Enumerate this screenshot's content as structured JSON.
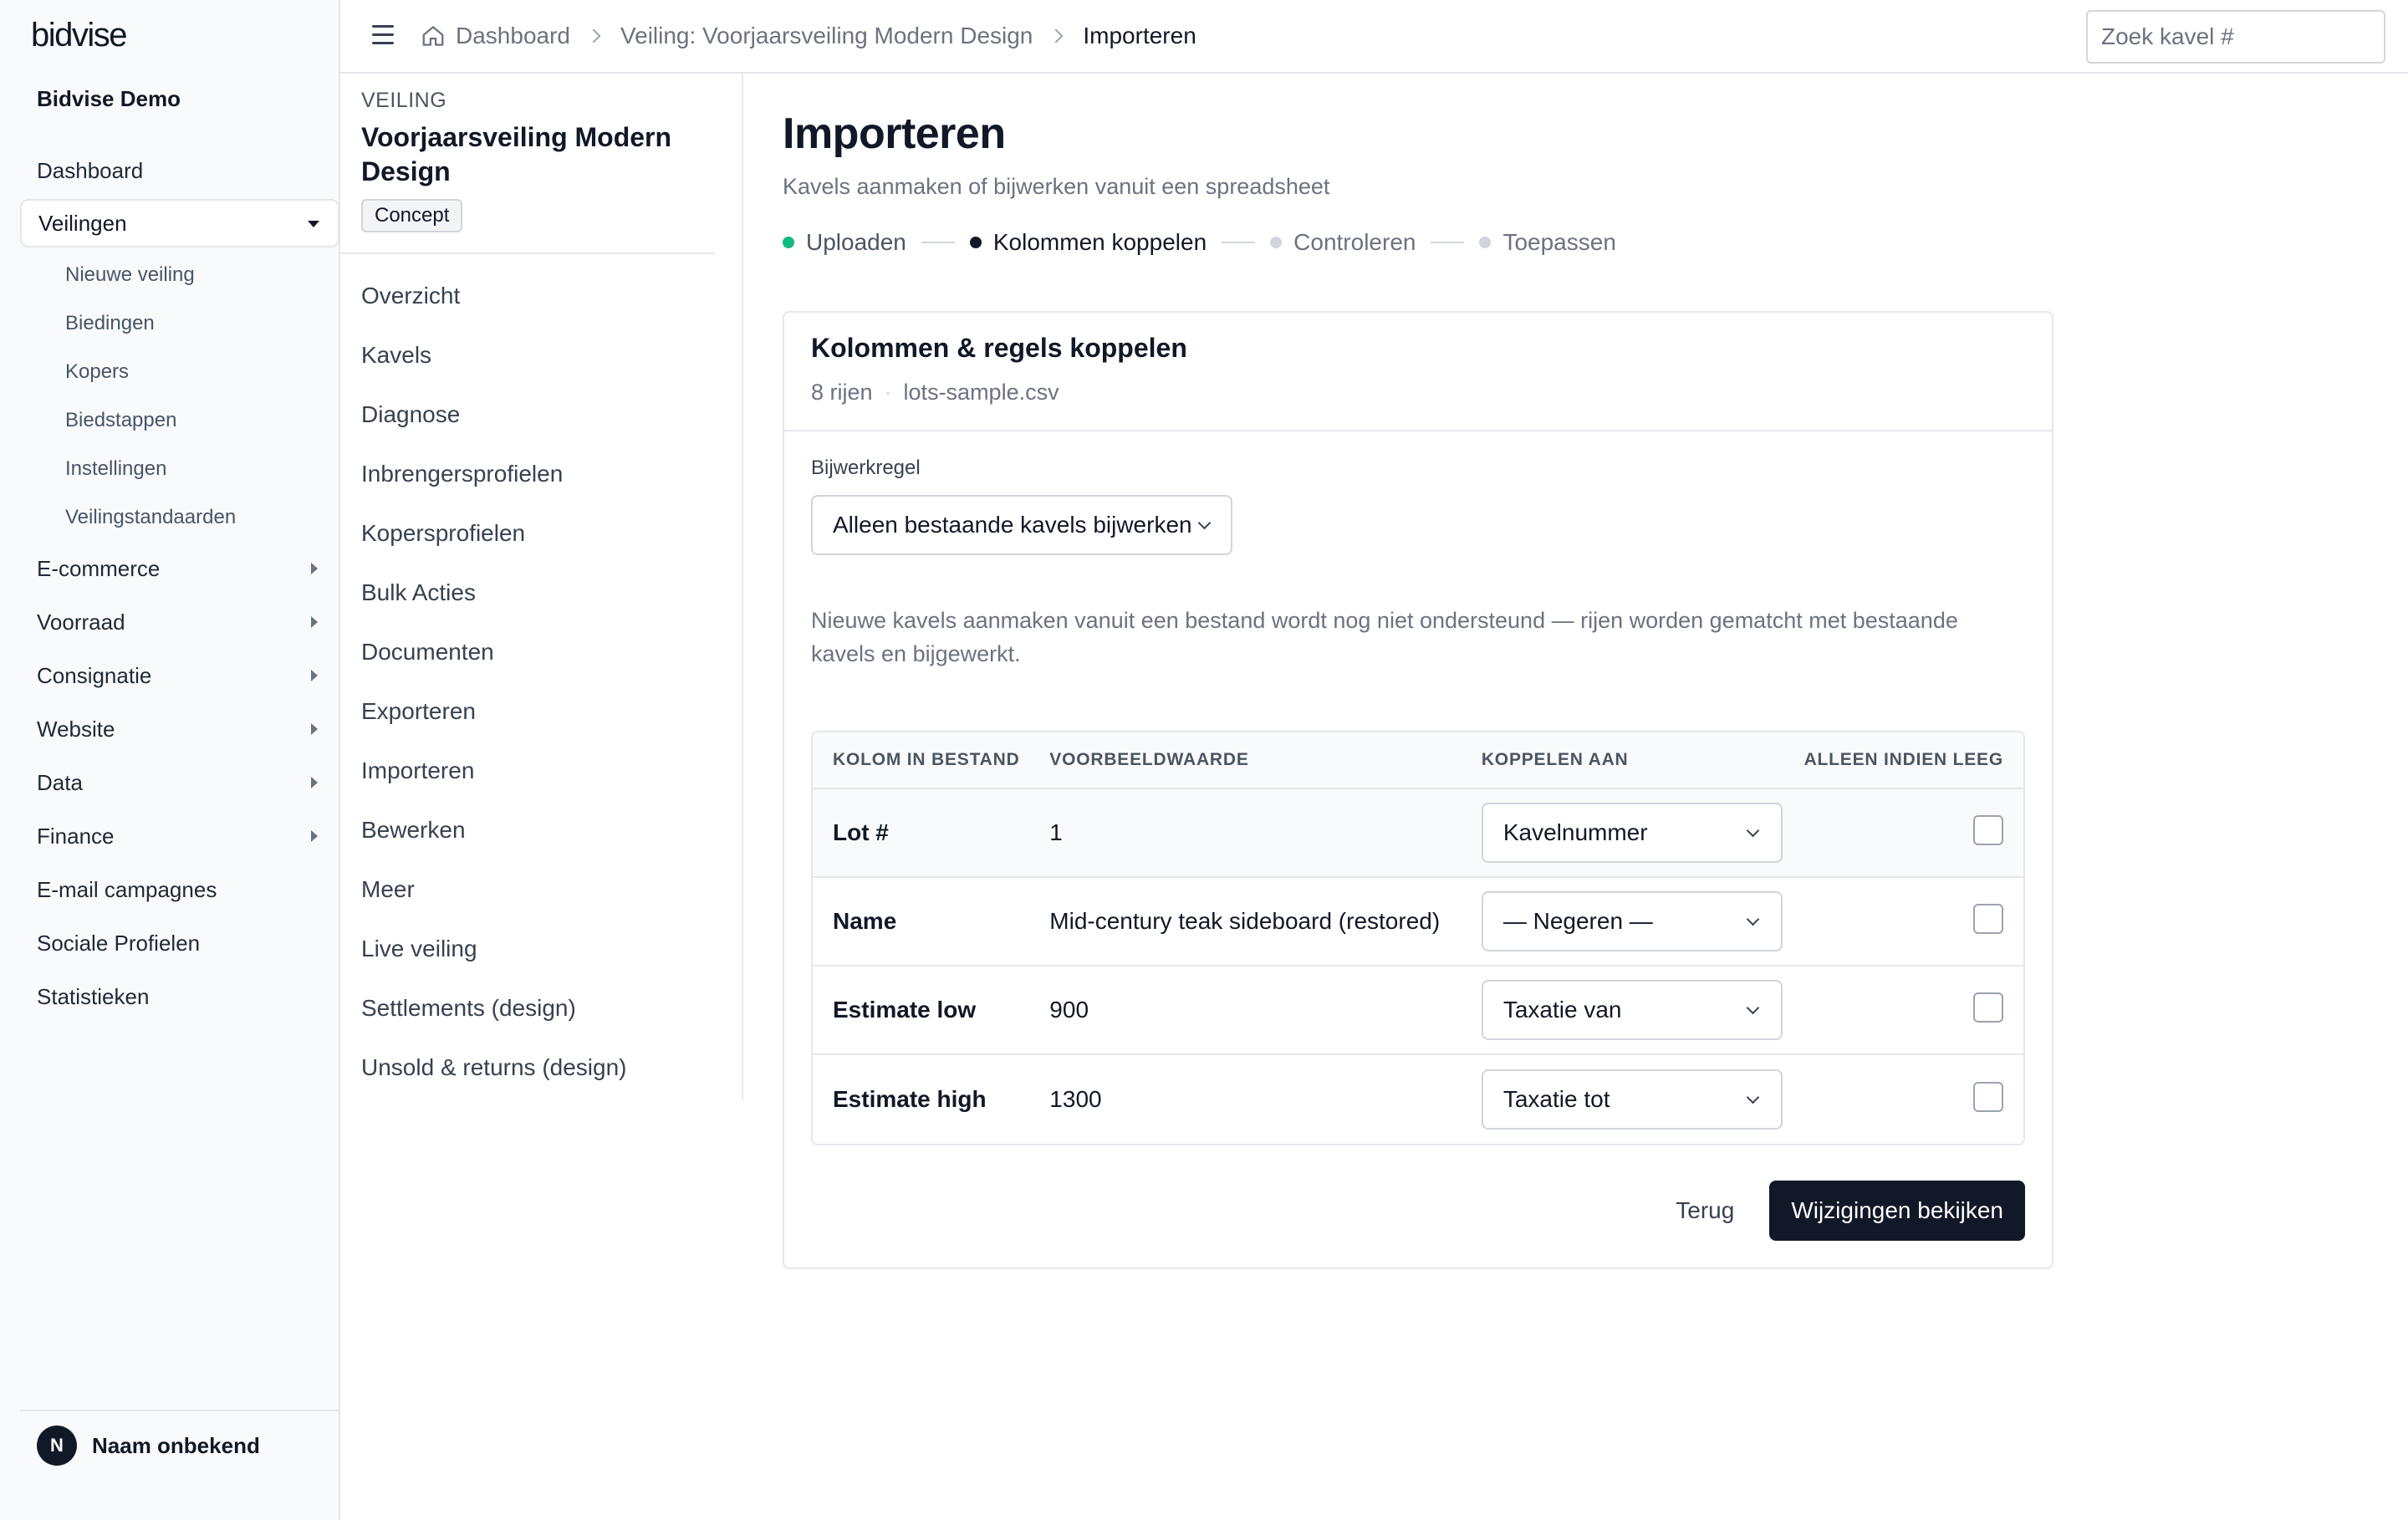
{
  "sidebar": {
    "brand": "bidvise",
    "org_name": "Bidvise Demo",
    "nav": [
      {
        "label": "Dashboard"
      },
      {
        "label": "Veilingen",
        "expanded": true
      },
      {
        "label": "E-commerce"
      },
      {
        "label": "Voorraad"
      },
      {
        "label": "Consignatie"
      },
      {
        "label": "Website"
      },
      {
        "label": "Data"
      },
      {
        "label": "Finance"
      },
      {
        "label": "E-mail campagnes"
      },
      {
        "label": "Sociale Profielen"
      },
      {
        "label": "Statistieken"
      }
    ],
    "subnav": [
      {
        "label": "Nieuwe veiling"
      },
      {
        "label": "Biedingen"
      },
      {
        "label": "Kopers"
      },
      {
        "label": "Biedstappen"
      },
      {
        "label": "Instellingen"
      },
      {
        "label": "Veilingstandaarden"
      }
    ],
    "user": {
      "initial": "N",
      "name": "Naam onbekend"
    }
  },
  "topbar": {
    "breadcrumbs": [
      {
        "label": "Dashboard"
      },
      {
        "label": "Veiling: Voorjaarsveiling Modern Design"
      },
      {
        "label": "Importeren"
      }
    ],
    "search_placeholder": "Zoek kavel #"
  },
  "auction": {
    "kicker": "VEILING",
    "title": "Voorjaarsveiling Modern Design",
    "status": "Concept",
    "nav": [
      {
        "label": "Overzicht"
      },
      {
        "label": "Kavels"
      },
      {
        "label": "Diagnose"
      },
      {
        "label": "Inbrengersprofielen"
      },
      {
        "label": "Kopersprofielen"
      },
      {
        "label": "Bulk Acties"
      },
      {
        "label": "Documenten"
      },
      {
        "label": "Exporteren"
      },
      {
        "label": "Importeren"
      },
      {
        "label": "Bewerken"
      },
      {
        "label": "Meer"
      },
      {
        "label": "Live veiling"
      },
      {
        "label": "Settlements (design)"
      },
      {
        "label": "Unsold & returns (design)"
      }
    ]
  },
  "main": {
    "title": "Importeren",
    "subtitle": "Kavels aanmaken of bijwerken vanuit een spreadsheet",
    "steps": [
      {
        "label": "Uploaden",
        "state": "done"
      },
      {
        "label": "Kolommen koppelen",
        "state": "active"
      },
      {
        "label": "Controleren",
        "state": "pending"
      },
      {
        "label": "Toepassen",
        "state": "pending"
      }
    ],
    "card": {
      "title": "Kolommen & regels koppelen",
      "rows_count": "8 rijen",
      "file_name": "lots-sample.csv",
      "rule_label": "Bijwerkregel",
      "rule_value": "Alleen bestaande kavels bijwerken",
      "notice": "Nieuwe kavels aanmaken vanuit een bestand wordt nog niet ondersteund — rijen worden gematcht met bestaande kavels en bijgewerkt.",
      "table": {
        "headers": [
          "KOLOM IN BESTAND",
          "VOORBEELDWAARDE",
          "KOPPELEN AAN",
          "ALLEEN INDIEN LEEG"
        ],
        "rows": [
          {
            "column": "Lot #",
            "sample": "1",
            "mapping": "Kavelnummer",
            "only_if_empty": false
          },
          {
            "column": "Name",
            "sample": "Mid-century teak sideboard (restored)",
            "mapping": "— Negeren —",
            "only_if_empty": false
          },
          {
            "column": "Estimate low",
            "sample": "900",
            "mapping": "Taxatie van",
            "only_if_empty": false
          },
          {
            "column": "Estimate high",
            "sample": "1300",
            "mapping": "Taxatie tot",
            "only_if_empty": false
          }
        ]
      },
      "back_label": "Terug",
      "primary_label": "Wijzigingen bekijken"
    }
  },
  "colors": {
    "primary": "#111827",
    "step_done": "#10b981",
    "border": "#e5e7eb",
    "muted_text": "#6b7280"
  }
}
